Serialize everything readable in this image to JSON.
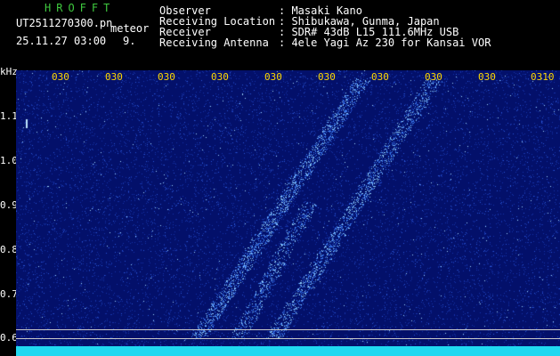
{
  "header": {
    "brand": "HROFFT",
    "filename": "UT2511270300.pn",
    "tag": "meteor",
    "timestamp": "25.11.27 03:00",
    "count": "9.",
    "labels": [
      "Observer",
      "Receiving Location",
      "Receiver",
      "Receiving Antenna"
    ],
    "values": [
      ": Masaki Kano",
      ": Shibukawa, Gunma, Japan",
      ": SDR# 43dB L15 111.6MHz USB",
      ": 4ele Yagi Az 230 for Kansai VOR"
    ]
  },
  "axis": {
    "unit": "kHz",
    "y_ticks": [
      "1.1",
      "1.0",
      "0.9",
      "0.8",
      "0.7",
      "0.6"
    ],
    "x_ticks": [
      "030",
      "030",
      "030",
      "030",
      "030",
      "030",
      "030",
      "030",
      "030",
      "030",
      "0310"
    ]
  },
  "colors": {
    "background": "#03106a",
    "signal": "#8fd0ff",
    "tick_text": "#ffd800",
    "brand": "#3ec83e"
  }
}
